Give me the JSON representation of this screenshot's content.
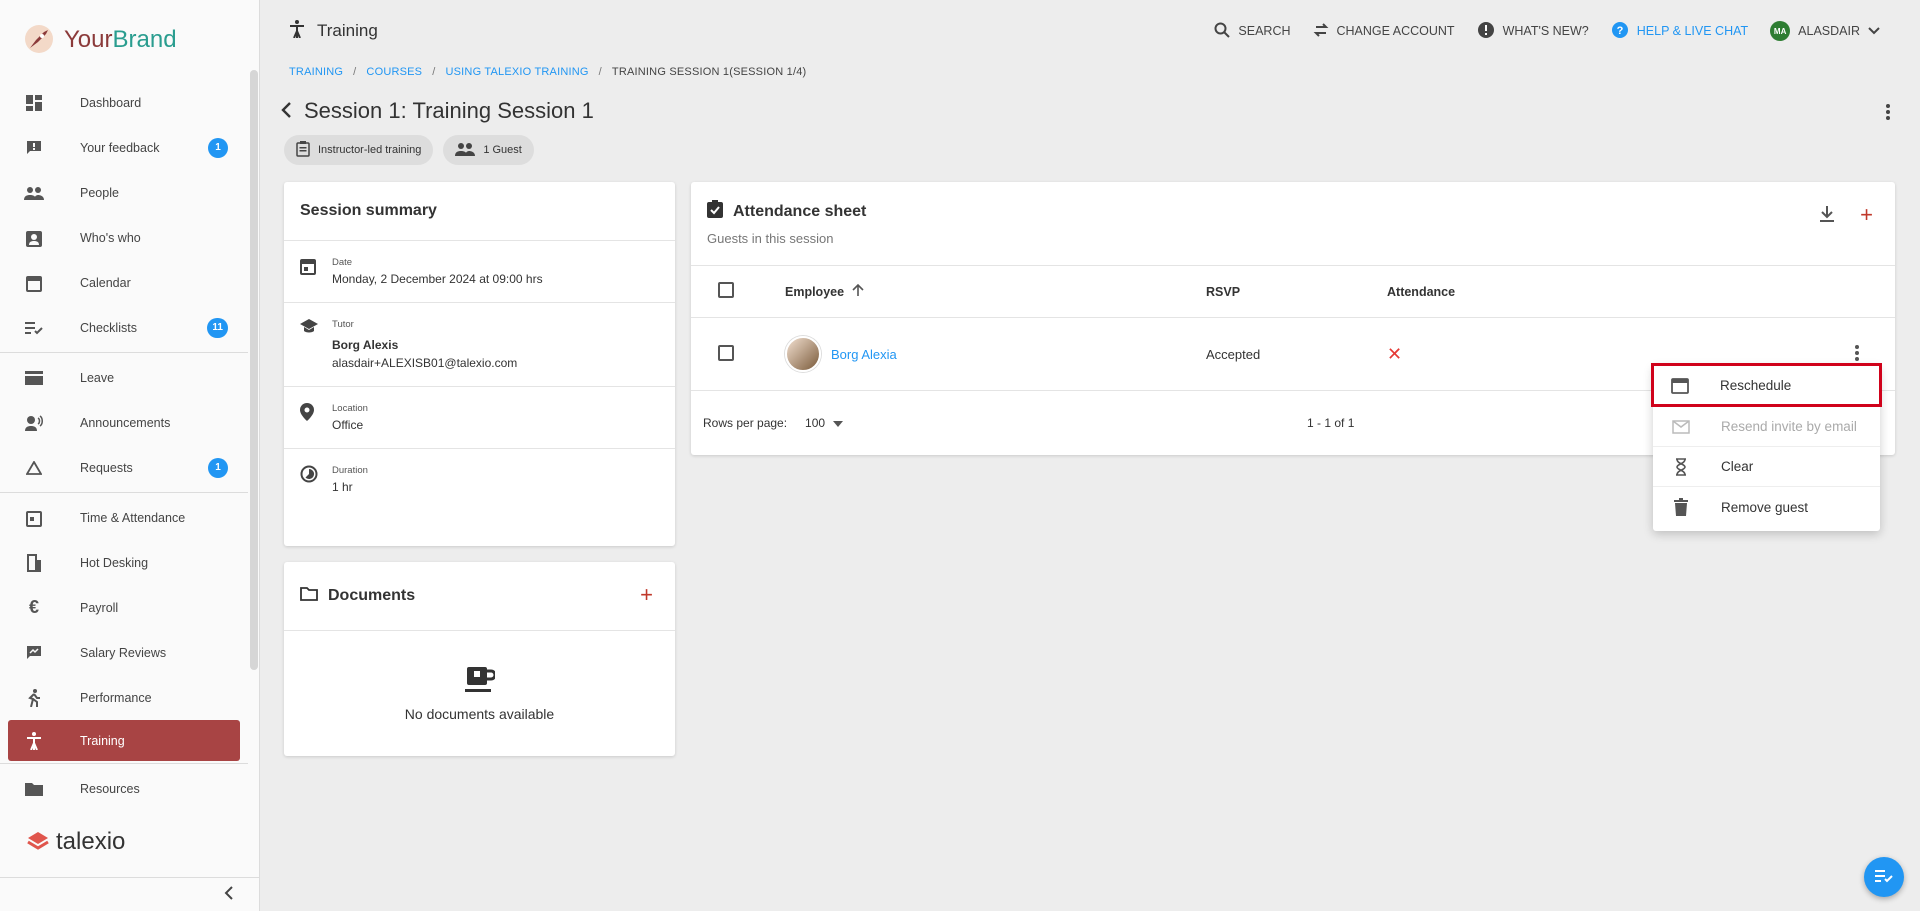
{
  "brand": {
    "name_part1": "Your",
    "name_part2": "Brand",
    "footer_logo": "talexio"
  },
  "sidebar": {
    "items": [
      {
        "label": "Dashboard",
        "icon": "dashboard-icon"
      },
      {
        "label": "Your feedback",
        "icon": "feedback-icon",
        "badge": "1"
      },
      {
        "label": "People",
        "icon": "people-icon"
      },
      {
        "label": "Who's who",
        "icon": "contact-icon"
      },
      {
        "label": "Calendar",
        "icon": "calendar-icon"
      },
      {
        "label": "Checklists",
        "icon": "checklist-icon",
        "badge": "11"
      },
      {
        "label": "Leave",
        "icon": "leave-icon"
      },
      {
        "label": "Announcements",
        "icon": "announcement-icon"
      },
      {
        "label": "Requests",
        "icon": "requests-icon",
        "badge": "1"
      },
      {
        "label": "Time & Attendance",
        "icon": "time-icon"
      },
      {
        "label": "Hot Desking",
        "icon": "desk-icon"
      },
      {
        "label": "Payroll",
        "icon": "euro-icon"
      },
      {
        "label": "Salary Reviews",
        "icon": "salary-icon"
      },
      {
        "label": "Performance",
        "icon": "performance-icon"
      },
      {
        "label": "Training",
        "icon": "training-icon",
        "active": true
      },
      {
        "label": "Resources",
        "icon": "folder-icon"
      }
    ]
  },
  "topbar": {
    "page_title": "Training",
    "search": "SEARCH",
    "change_account": "CHANGE ACCOUNT",
    "whats_new": "WHAT'S NEW?",
    "help": "HELP & LIVE CHAT",
    "user_initials": "MA",
    "user_name": "ALASDAIR"
  },
  "breadcrumb": {
    "items": [
      "TRAINING",
      "COURSES",
      "USING TALEXIO TRAINING"
    ],
    "current": "TRAINING SESSION 1(SESSION 1/4)"
  },
  "session": {
    "title": "Session 1: Training Session 1",
    "chip_type": "Instructor-led training",
    "chip_guests": "1 Guest"
  },
  "summary": {
    "heading": "Session summary",
    "date_label": "Date",
    "date_value": "Monday, 2 December 2024 at 09:00 hrs",
    "tutor_label": "Tutor",
    "tutor_name": "Borg Alexis",
    "tutor_email": "alasdair+ALEXISB01@talexio.com",
    "location_label": "Location",
    "location_value": "Office",
    "duration_label": "Duration",
    "duration_value": "1 hr"
  },
  "documents": {
    "heading": "Documents",
    "empty": "No documents available"
  },
  "attendance": {
    "heading": "Attendance sheet",
    "subheading": "Guests in this session",
    "col_employee": "Employee",
    "col_rsvp": "RSVP",
    "col_attendance": "Attendance",
    "rows": [
      {
        "name": "Borg Alexia",
        "rsvp": "Accepted",
        "attendance": "✕"
      }
    ],
    "rows_per_page_label": "Rows per page:",
    "rows_per_page": "100",
    "range": "1 - 1 of 1"
  },
  "menu": {
    "reschedule": "Reschedule",
    "resend": "Resend invite by email",
    "clear": "Clear",
    "remove": "Remove guest"
  },
  "colors": {
    "accent": "#a84444",
    "link": "#2196f3",
    "add": "#c0392b",
    "highlight": "#d0021b"
  }
}
